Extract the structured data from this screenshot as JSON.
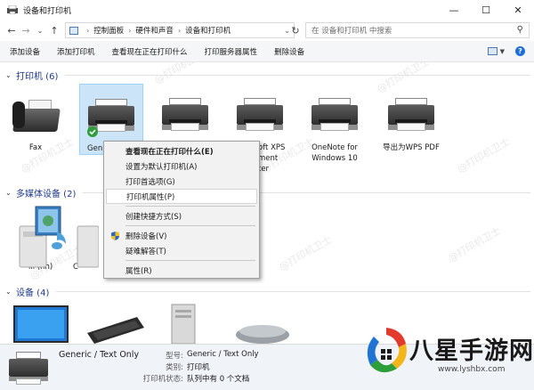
{
  "window": {
    "title": "设备和打印机",
    "minimize": "—",
    "maximize": "☐",
    "close": "✕"
  },
  "address": {
    "crumbs": [
      "控制面板",
      "硬件和声音",
      "设备和打印机"
    ],
    "search_placeholder": "在 设备和打印机 中搜索"
  },
  "toolbar": {
    "commands": [
      "添加设备",
      "添加打印机",
      "查看现在正在打印什么",
      "打印服务器属性",
      "删除设备"
    ]
  },
  "groups": {
    "printers": {
      "label": "打印机 (6)"
    },
    "multimedia": {
      "label": "多媒体设备 (2)"
    },
    "devices": {
      "label": "设备 (4)"
    }
  },
  "printers": [
    {
      "label": "Fax",
      "icon": "fax-icon"
    },
    {
      "label": "Generic / Text Only",
      "label_visible": "Gen",
      "icon": "printer-icon",
      "selected": true
    },
    {
      "label": "",
      "icon": "printer-icon"
    },
    {
      "label": "oft XPS\nment\nter",
      "icon": "printer-icon"
    },
    {
      "label": "OneNote for\nWindows 10",
      "icon": "printer-icon"
    },
    {
      "label": "导出为WPS PDF",
      "icon": "printer-icon"
    }
  ],
  "multimedia": [
    {
      "label": "iii (hh)",
      "icon": "media-device-icon"
    },
    {
      "label": "C",
      "icon": "media-device-icon"
    }
  ],
  "context_menu": {
    "items": [
      {
        "label": "查看现在正在打印什么(E)",
        "bold": true
      },
      {
        "label": "设置为默认打印机(A)"
      },
      {
        "label": "打印首选项(G)"
      },
      {
        "label": "打印机属性(P)",
        "highlighted": true
      },
      {
        "separator": true
      },
      {
        "label": "创建快捷方式(S)"
      },
      {
        "separator": true
      },
      {
        "label": "删除设备(V)",
        "shield": true
      },
      {
        "label": "疑难解答(T)"
      },
      {
        "separator": true
      },
      {
        "label": "属性(R)"
      }
    ]
  },
  "details": {
    "name": "Generic / Text Only",
    "model_key": "型号:",
    "model_value": "Generic / Text Only",
    "category_key": "类别:",
    "category_value": "打印机",
    "status_key": "打印机状态:",
    "status_value": "队列中有 0 个文档"
  },
  "watermark": "@打印机卫士",
  "brand": {
    "name": "八星手游网",
    "url": "www.lyshbx.com"
  }
}
